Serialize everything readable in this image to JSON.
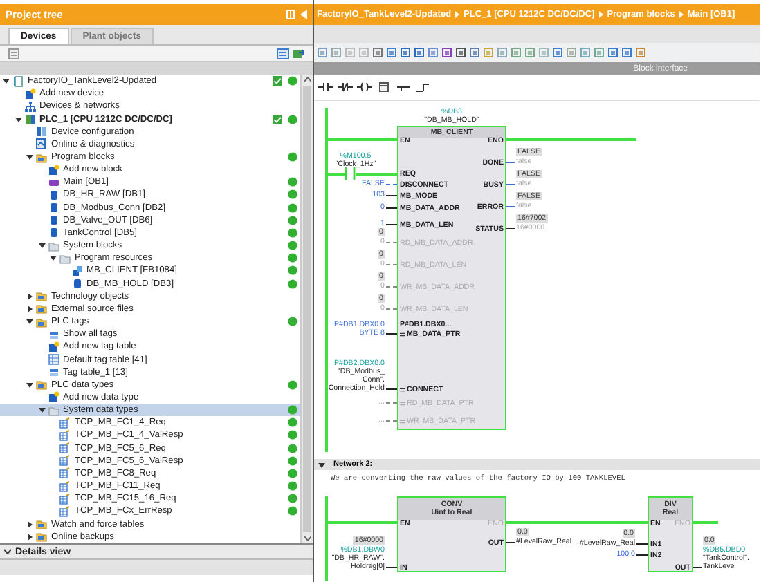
{
  "project_tree": {
    "title": "Project tree",
    "tabs": [
      {
        "label": "Devices",
        "selected": true
      },
      {
        "label": "Plant objects",
        "selected": false
      }
    ],
    "items": [
      {
        "label": "FactoryIO_TankLevel2-Updated",
        "kind": "project",
        "expanded": true,
        "check": true,
        "dot": true,
        "selected": false,
        "children": [
          {
            "label": "Add new device",
            "kind": "add",
            "check": false,
            "dot": false,
            "selected": false
          },
          {
            "label": "Devices & networks",
            "kind": "network",
            "check": false,
            "dot": false,
            "selected": false
          },
          {
            "label": "PLC_1 [CPU 1212C DC/DC/DC]",
            "kind": "plc",
            "expanded": true,
            "check": true,
            "dot": true,
            "selected": false,
            "children": [
              {
                "label": "Device configuration",
                "kind": "config",
                "check": false,
                "dot": false,
                "selected": false
              },
              {
                "label": "Online & diagnostics",
                "kind": "online",
                "check": false,
                "dot": false,
                "selected": false
              },
              {
                "label": "Program blocks",
                "kind": "folder",
                "expanded": true,
                "check": false,
                "dot": true,
                "selected": false,
                "children": [
                  {
                    "label": "Add new block",
                    "kind": "add",
                    "check": false,
                    "dot": false,
                    "selected": false
                  },
                  {
                    "label": "Main [OB1]",
                    "kind": "ob",
                    "check": false,
                    "dot": true,
                    "selected": false
                  },
                  {
                    "label": "DB_HR_RAW [DB1]",
                    "kind": "db",
                    "check": false,
                    "dot": true,
                    "selected": false
                  },
                  {
                    "label": "DB_Modbus_Conn [DB2]",
                    "kind": "db",
                    "check": false,
                    "dot": true,
                    "selected": false
                  },
                  {
                    "label": "DB_Valve_OUT [DB6]",
                    "kind": "db",
                    "check": false,
                    "dot": true,
                    "selected": false
                  },
                  {
                    "label": "TankControl [DB5]",
                    "kind": "db",
                    "check": false,
                    "dot": true,
                    "selected": false
                  },
                  {
                    "label": "System blocks",
                    "kind": "sysfolder",
                    "expanded": true,
                    "check": false,
                    "dot": true,
                    "selected": false,
                    "children": [
                      {
                        "label": "Program resources",
                        "kind": "sysfolder",
                        "expanded": true,
                        "check": false,
                        "dot": true,
                        "selected": false,
                        "children": [
                          {
                            "label": "MB_CLIENT [FB1084]",
                            "kind": "fb",
                            "check": false,
                            "dot": true,
                            "selected": false
                          },
                          {
                            "label": "DB_MB_HOLD [DB3]",
                            "kind": "db",
                            "check": false,
                            "dot": true,
                            "selected": false
                          }
                        ]
                      }
                    ]
                  }
                ]
              },
              {
                "label": "Technology objects",
                "kind": "folder",
                "expanded": false,
                "check": false,
                "dot": false,
                "selected": false
              },
              {
                "label": "External source files",
                "kind": "folder",
                "expanded": false,
                "check": false,
                "dot": false,
                "selected": false
              },
              {
                "label": "PLC tags",
                "kind": "folder",
                "expanded": true,
                "check": false,
                "dot": true,
                "selected": false,
                "children": [
                  {
                    "label": "Show all tags",
                    "kind": "tags",
                    "check": false,
                    "dot": false,
                    "selected": false
                  },
                  {
                    "label": "Add new tag table",
                    "kind": "add",
                    "check": false,
                    "dot": false,
                    "selected": false
                  },
                  {
                    "label": "Default tag table [41]",
                    "kind": "table",
                    "check": false,
                    "dot": false,
                    "selected": false
                  },
                  {
                    "label": "Tag table_1 [13]",
                    "kind": "tags",
                    "check": false,
                    "dot": false,
                    "selected": false
                  }
                ]
              },
              {
                "label": "PLC data types",
                "kind": "folder",
                "expanded": true,
                "check": false,
                "dot": true,
                "selected": false,
                "children": [
                  {
                    "label": "Add new data type",
                    "kind": "add",
                    "check": false,
                    "dot": false,
                    "selected": false
                  },
                  {
                    "label": "System data types",
                    "kind": "sysfolder",
                    "expanded": true,
                    "check": false,
                    "dot": true,
                    "selected": true,
                    "children": [
                      {
                        "label": "TCP_MB_FC1_4_Req",
                        "kind": "datatype",
                        "check": false,
                        "dot": true,
                        "selected": false
                      },
                      {
                        "label": "TCP_MB_FC1_4_ValResp",
                        "kind": "datatype",
                        "check": false,
                        "dot": true,
                        "selected": false
                      },
                      {
                        "label": "TCP_MB_FC5_6_Req",
                        "kind": "datatype",
                        "check": false,
                        "dot": true,
                        "selected": false
                      },
                      {
                        "label": "TCP_MB_FC5_6_ValResp",
                        "kind": "datatype",
                        "check": false,
                        "dot": true,
                        "selected": false
                      },
                      {
                        "label": "TCP_MB_FC8_Req",
                        "kind": "datatype",
                        "check": false,
                        "dot": true,
                        "selected": false
                      },
                      {
                        "label": "TCP_MB_FC11_Req",
                        "kind": "datatype",
                        "check": false,
                        "dot": true,
                        "selected": false
                      },
                      {
                        "label": "TCP_MB_FC15_16_Req",
                        "kind": "datatype",
                        "check": false,
                        "dot": true,
                        "selected": false
                      },
                      {
                        "label": "TCP_MB_FCx_ErrResp",
                        "kind": "datatype",
                        "check": false,
                        "dot": true,
                        "selected": false
                      }
                    ]
                  }
                ]
              },
              {
                "label": "Watch and force tables",
                "kind": "folder",
                "expanded": false,
                "check": false,
                "dot": false,
                "selected": false
              },
              {
                "label": "Online backups",
                "kind": "folder",
                "expanded": false,
                "check": false,
                "dot": false,
                "selected": false
              }
            ]
          }
        ]
      }
    ],
    "details_view": "Details view"
  },
  "editor": {
    "breadcrumb": [
      "FactoryIO_TankLevel2-Updated",
      "PLC_1 [CPU 1212C DC/DC/DC]",
      "Program blocks",
      "Main [OB1]"
    ],
    "block_interface": "Block interface",
    "networks": [
      {
        "blocks": [
          {
            "kind": "mb_client",
            "instance": [
              "%DB3",
              "\"DB_MB_HOLD\""
            ],
            "title": [
              "MB_CLIENT"
            ],
            "en": "EN",
            "eno": "ENO",
            "eno_disabled": false,
            "inputs": [
              {
                "pin": "REQ",
                "kind": "contact",
                "address": "%M100.5",
                "symbol": [
                  "\"Clock_1Hz\""
                ]
              },
              {
                "pin": "DISCONNECT",
                "kind": "bool",
                "constant": [
                  "FALSE"
                ]
              },
              {
                "pin": "MB_MODE",
                "kind": "value",
                "constant": [
                  "103"
                ]
              },
              {
                "pin": "MB_DATA_ADDR",
                "kind": "value",
                "constant": [
                  "0"
                ]
              },
              {
                "pin": "MB_DATA_LEN",
                "kind": "value",
                "constant": [
                  "1"
                ]
              },
              {
                "pin": "RD_MB_DATA_ADDR",
                "kind": "value",
                "disabled": true,
                "monitor": "0",
                "constant": [
                  "0"
                ]
              },
              {
                "pin": "RD_MB_DATA_LEN",
                "kind": "value",
                "disabled": true,
                "monitor": "0",
                "constant": [
                  "0"
                ]
              },
              {
                "pin": "WR_MB_DATA_ADDR",
                "kind": "value",
                "disabled": true,
                "monitor": "0",
                "constant": [
                  "0"
                ]
              },
              {
                "pin": "WR_MB_DATA_LEN",
                "kind": "value",
                "disabled": true,
                "monitor": "0",
                "constant": [
                  "0"
                ]
              },
              {
                "pin": "MB_DATA_PTR",
                "kind": "inout",
                "inner": "P#DB1.DBX0...",
                "constant": [
                  "P#DB1.DBX0.0",
                  "BYTE 8"
                ]
              },
              {
                "pin": "CONNECT",
                "kind": "inout",
                "address": "P#DB2.DBX0.0",
                "symbol": [
                  "\"DB_Modbus_",
                  "Conn\".",
                  "Connection_Hold"
                ]
              },
              {
                "pin": "RD_MB_DATA_PTR",
                "kind": "inout",
                "disabled": true,
                "constant": [
                  "..."
                ]
              },
              {
                "pin": "WR_MB_DATA_PTR",
                "kind": "inout",
                "disabled": true,
                "constant": [
                  "..."
                ]
              }
            ],
            "outputs": [
              {
                "pin": "DONE",
                "kind": "bool",
                "monitor": "FALSE",
                "default": "false"
              },
              {
                "pin": "BUSY",
                "kind": "bool",
                "monitor": "FALSE",
                "default": "false"
              },
              {
                "pin": "ERROR",
                "kind": "bool",
                "monitor": "FALSE",
                "default": "false"
              },
              {
                "pin": "STATUS",
                "kind": "value",
                "monitor": "16#7002",
                "default": "16#0000"
              }
            ]
          }
        ]
      },
      {
        "header": "Network 2:",
        "expanded": true,
        "comment": "We are converting the raw values of the factory IO by 100 TANKLEVEL",
        "blocks": [
          {
            "kind": "conv",
            "title": [
              "CONV",
              "Uint to Real"
            ],
            "en": "EN",
            "eno": "ENO",
            "eno_disabled": true,
            "inputs": [
              {
                "pin": "IN",
                "kind": "value",
                "monitor": "16#0000",
                "address": "%DB1.DBW0",
                "symbol": [
                  "\"DB_HR_RAW\".",
                  "Holdreg[0]"
                ]
              }
            ],
            "outputs": [
              {
                "pin": "OUT",
                "kind": "value",
                "monitor": "0.0",
                "symbol": [
                  "#LevelRaw_Real"
                ]
              }
            ]
          },
          {
            "kind": "div",
            "title": [
              "DIV",
              "Real"
            ],
            "en": "EN",
            "eno": "ENO",
            "eno_disabled": true,
            "inputs": [
              {
                "pin": "IN1",
                "kind": "value",
                "monitor": "0.0",
                "symbol": [
                  "#LevelRaw_Real"
                ]
              },
              {
                "pin": "IN2",
                "kind": "value",
                "constant": [
                  "100.0"
                ]
              }
            ],
            "outputs": [
              {
                "pin": "OUT",
                "kind": "value",
                "monitor": "0.0",
                "address": "%DB5.DBD0",
                "symbol": [
                  "\"TankControl\".",
                  "TankLevel"
                ]
              }
            ]
          }
        ]
      }
    ]
  }
}
